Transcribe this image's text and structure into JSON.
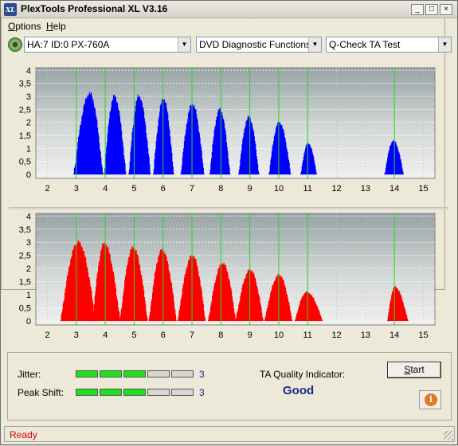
{
  "window": {
    "title": "PlexTools Professional XL V3.16",
    "icon_text": "XL"
  },
  "title_buttons": {
    "minimize": "_",
    "maximize": "□",
    "close": "×"
  },
  "menu": [
    {
      "label": "Options",
      "hotkey": "O",
      "rest": "ptions"
    },
    {
      "label": "Help",
      "hotkey": "H",
      "rest": "elp"
    }
  ],
  "toolbar": {
    "drive_value": "HA:7 ID:0  PX-760A",
    "function_value": "DVD Diagnostic Functions",
    "test_value": "Q-Check TA Test"
  },
  "chart_data": [
    {
      "type": "bar",
      "name": "",
      "color": "#0000ff",
      "x_ticks": [
        "2",
        "3",
        "4",
        "5",
        "6",
        "7",
        "8",
        "9",
        "10",
        "11",
        "12",
        "13",
        "14",
        "15"
      ],
      "y_ticks": [
        "0",
        "0,5",
        "1",
        "1,5",
        "2",
        "2,5",
        "3",
        "3,5",
        "4"
      ],
      "xlim": [
        1.6,
        15.4
      ],
      "ylim": [
        -0.15,
        4.1
      ],
      "grid_lines_x": [
        3,
        4,
        5,
        6,
        7,
        8,
        9,
        10,
        11,
        14
      ],
      "peaks": [
        {
          "center": 3.45,
          "height": 3.1,
          "start": 2.9,
          "end": 3.9
        },
        {
          "center": 4.3,
          "height": 3.0,
          "start": 3.95,
          "end": 4.7
        },
        {
          "center": 5.15,
          "height": 3.0,
          "start": 4.8,
          "end": 5.55
        },
        {
          "center": 6.0,
          "height": 2.9,
          "start": 5.65,
          "end": 6.35
        },
        {
          "center": 7.0,
          "height": 2.7,
          "start": 6.6,
          "end": 7.4
        },
        {
          "center": 7.95,
          "height": 2.5,
          "start": 7.6,
          "end": 8.3
        },
        {
          "center": 8.95,
          "height": 2.2,
          "start": 8.6,
          "end": 9.3
        },
        {
          "center": 10.0,
          "height": 2.0,
          "start": 9.65,
          "end": 10.4
        },
        {
          "center": 11.0,
          "height": 1.2,
          "start": 10.75,
          "end": 11.3
        },
        {
          "center": 13.95,
          "height": 1.3,
          "start": 13.65,
          "end": 14.3
        }
      ]
    },
    {
      "type": "bar",
      "name": "",
      "color": "#ff0000",
      "x_ticks": [
        "2",
        "3",
        "4",
        "5",
        "6",
        "7",
        "8",
        "9",
        "10",
        "11",
        "12",
        "13",
        "14",
        "15"
      ],
      "y_ticks": [
        "0",
        "0,5",
        "1",
        "1,5",
        "2",
        "2,5",
        "3",
        "3,5",
        "4"
      ],
      "xlim": [
        1.6,
        15.4
      ],
      "ylim": [
        -0.15,
        4.1
      ],
      "grid_lines_x": [
        3,
        4,
        5,
        6,
        7,
        8,
        9,
        10,
        11,
        14
      ],
      "peaks": [
        {
          "center": 3.05,
          "height": 3.0,
          "start": 2.45,
          "end": 3.65
        },
        {
          "center": 3.95,
          "height": 2.95,
          "start": 3.55,
          "end": 4.5
        },
        {
          "center": 4.95,
          "height": 2.8,
          "start": 4.5,
          "end": 5.45
        },
        {
          "center": 5.95,
          "height": 2.7,
          "start": 5.5,
          "end": 6.45
        },
        {
          "center": 7.0,
          "height": 2.5,
          "start": 6.5,
          "end": 7.45
        },
        {
          "center": 8.05,
          "height": 2.2,
          "start": 7.55,
          "end": 8.5
        },
        {
          "center": 9.0,
          "height": 1.95,
          "start": 8.5,
          "end": 9.45
        },
        {
          "center": 10.0,
          "height": 1.75,
          "start": 9.5,
          "end": 10.45
        },
        {
          "center": 10.95,
          "height": 1.1,
          "start": 10.55,
          "end": 11.5
        },
        {
          "center": 14.0,
          "height": 1.3,
          "start": 13.75,
          "end": 14.45
        }
      ]
    }
  ],
  "metrics": {
    "jitter_label": "Jitter:",
    "jitter_value": "3",
    "jitter_level": 3,
    "peak_shift_label": "Peak Shift:",
    "peak_shift_value": "3",
    "peak_shift_level": 3,
    "segments_total": 5,
    "on_color": "#1ee01e",
    "off_color": "#d8d6cf"
  },
  "quality": {
    "label": "TA Quality Indicator:",
    "value": "Good"
  },
  "buttons": {
    "start": "Start",
    "start_hotkey": "S",
    "start_rest": "tart",
    "info": "i"
  },
  "status": {
    "text": "Ready"
  }
}
